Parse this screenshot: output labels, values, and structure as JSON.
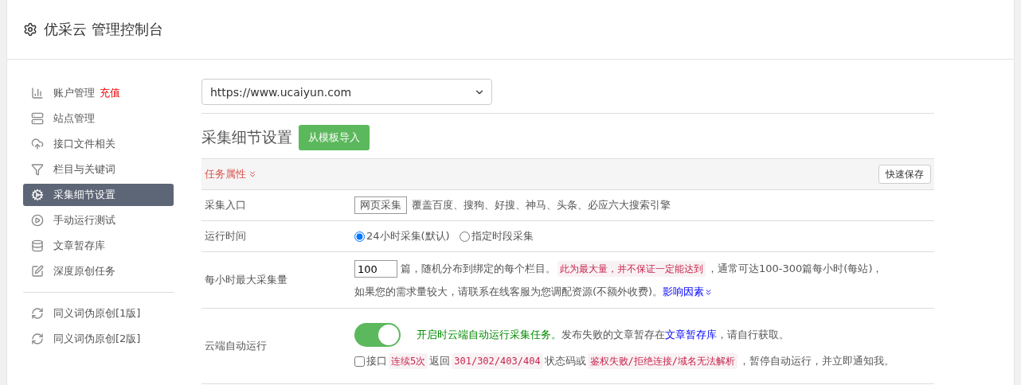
{
  "header": {
    "title": "优采云 管理控制台"
  },
  "sidebar": {
    "groups": [
      [
        {
          "label": "账户管理",
          "badge": "充值",
          "selected": false
        },
        {
          "label": "站点管理",
          "selected": false
        },
        {
          "label": "接口文件相关",
          "selected": false
        },
        {
          "label": "栏目与关键词",
          "selected": false
        },
        {
          "label": "采集细节设置",
          "selected": true
        },
        {
          "label": "手动运行测试",
          "selected": false
        },
        {
          "label": "文章暂存库",
          "selected": false
        },
        {
          "label": "深度原创任务",
          "selected": false
        }
      ],
      [
        {
          "label": "同义词伪原创[1版]",
          "selected": false
        },
        {
          "label": "同义词伪原创[2版]",
          "selected": false
        }
      ]
    ]
  },
  "site_select": {
    "value": "https://www.ucaiyun.com"
  },
  "section": {
    "title": "采集细节设置",
    "import_button": "从模板导入"
  },
  "panel": {
    "title": "任务属性",
    "save_button": "快速保存",
    "expanded": true
  },
  "rows": [
    {
      "kind": "entry",
      "label": "采集入口",
      "tag": "网页采集",
      "text": "覆盖百度、搜狗、好搜、神马、头条、必应六大搜索引擎"
    },
    {
      "kind": "radios",
      "label": "运行时间",
      "options": [
        {
          "label": "24小时采集(默认)",
          "selected": true
        },
        {
          "label": "指定时段采集",
          "selected": false
        }
      ]
    },
    {
      "kind": "amount",
      "label": "每小时最大采集量",
      "value": "100",
      "lines": [
        [
          {
            "kind": "plain",
            "text": "篇，随机分布到绑定的每个栏目。"
          },
          {
            "kind": "code",
            "text": "此为最大量，并不保证一定能达到"
          },
          {
            "kind": "plain",
            "text": "，通常可达100-300篇每小时(每站)，"
          }
        ],
        [
          {
            "kind": "plain",
            "text": "如果您的需求量较大，请联系在线客服为您调配资源(不额外收费)。"
          },
          {
            "kind": "dropdown-link",
            "text": "影响因素"
          }
        ]
      ]
    },
    {
      "kind": "cloud",
      "label": "云端自动运行",
      "on": true,
      "lines": [
        [
          {
            "kind": "green",
            "text": "开启时云端自动运行采集任务。"
          },
          {
            "kind": "plain",
            "text": "发布失败的文章暂存在"
          },
          {
            "kind": "link",
            "text": "文章暂存库"
          },
          {
            "kind": "plain",
            "text": "，请自行获取。"
          }
        ]
      ],
      "check": {
        "checked": false,
        "parts": [
          {
            "kind": "plain",
            "text": "接口"
          },
          {
            "kind": "code",
            "text": "连续5次"
          },
          {
            "kind": "plain",
            "text": "返回"
          },
          {
            "kind": "code",
            "text": "301/302/403/404"
          },
          {
            "kind": "plain",
            "text": "状态码或"
          },
          {
            "kind": "code",
            "text": "鉴权失败/拒绝连接/域名无法解析"
          },
          {
            "kind": "plain",
            "text": "，暂停自动运行，并立即通知我。"
          }
        ]
      }
    }
  ]
}
